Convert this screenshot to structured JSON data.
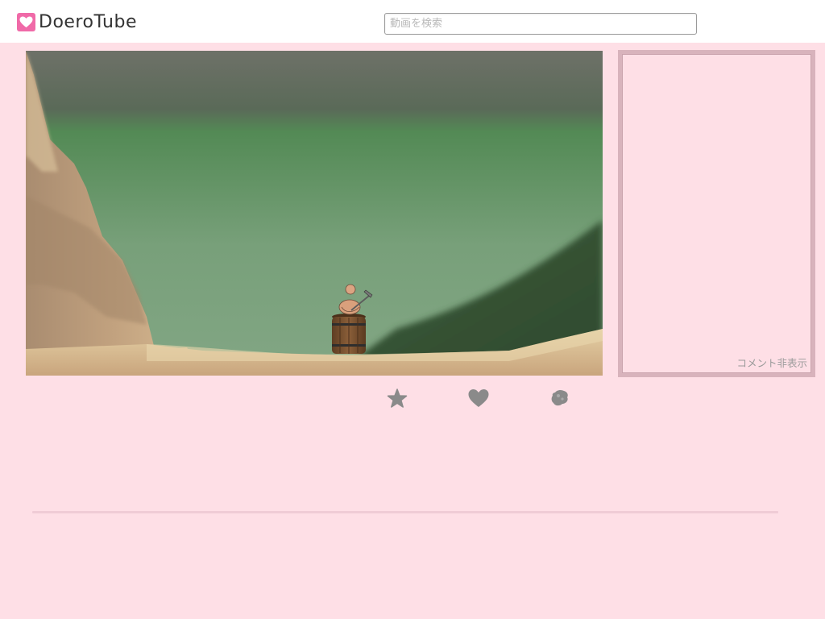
{
  "header": {
    "logo_text": "DoeroTube",
    "logo_icon": "heart-icon",
    "search_placeholder": "動画を検索",
    "search_value": ""
  },
  "player": {
    "scene": "climbing-game-video-frame"
  },
  "comments": {
    "toggle_label": "コメント非表示"
  },
  "actions": [
    {
      "name": "favorite",
      "icon": "star-icon"
    },
    {
      "name": "like",
      "icon": "heart-icon"
    },
    {
      "name": "share",
      "icon": "blob-icon"
    }
  ],
  "colors": {
    "background": "#fedfe6",
    "header": "#ffffff",
    "logo_accent": "#f06aa8",
    "panel_border": "#d8b3bc",
    "icon": "#8a8a8a"
  }
}
